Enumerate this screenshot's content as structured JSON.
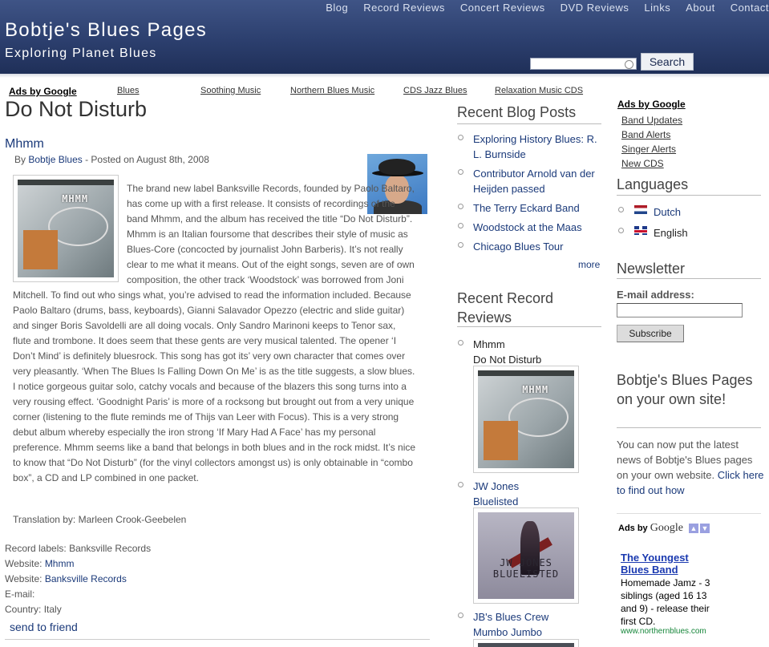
{
  "nav": [
    "Blog",
    "Record Reviews",
    "Concert Reviews",
    "DVD Reviews",
    "Links",
    "About",
    "Contact"
  ],
  "site": {
    "title": "Bobtje's Blues Pages",
    "subtitle": "Exploring Planet Blues"
  },
  "search": {
    "button": "Search",
    "value": ""
  },
  "ads_bar": {
    "label": "Ads by Google",
    "links": [
      "Blues",
      "Soothing Music",
      "Northern Blues Music",
      "CDS Jazz Blues",
      "Relaxation Music CDS"
    ]
  },
  "post": {
    "page_title": "Do Not Disturb",
    "title": "Mhmm",
    "by_prefix": "By",
    "author": "Bobtje Blues",
    "posted": " - Posted on August 8th, 2008",
    "cover_brand": "MHMM",
    "body": "The brand new label Banksville Records, founded by Paolo Baltaro, has come up with a first release. It consists of recordings of the band Mhmm, and the album has received the title “Do Not Disturb”. Mhmm is an Italian foursome that describes their style of music as Blues-Core (concocted by journalist John Barberis). It’s not really clear to me what it means. Out of the eight songs, seven are of own composition, the other track ‘Woodstock’ was borrowed from Joni Mitchell. To find out who sings what, you’re advised to read the information included. Because Paolo Baltaro (drums, bass, keyboards), Gianni Salavador Opezzo (electric and slide guitar) and singer Boris Savoldelli are all doing vocals. Only Sandro Marinoni keeps to Tenor sax, flute and trombone. It does seem that these gents are very musical talented. The opener ‘I Don’t Mind’ is definitely bluesrock. This song has got its’ very own character that comes over very pleasantly. ‘When The Blues Is Falling Down On Me’ is as the title suggests, a slow blues. I notice gorgeous guitar solo, catchy vocals and because of the blazers this song turns into a very rousing effect. ‘Goodnight Paris’ is more of a rocksong but brought out from a very unique corner (listening to the flute reminds me of Thijs van Leer with Focus). This is a very strong debut album whereby especially the iron strong ‘If Mary Had A Face’ has my personal preference. Mhmm seems like a band that belongs in both blues and in the rock midst. It’s nice to know that “Do Not Disturb” (for the vinyl collectors amongst us) is only obtainable in “combo box”, a CD and LP combined in one packet.",
    "translation": "Translation by: Marleen Crook-Geebelen",
    "meta": {
      "record_labels_label": "Record labels:",
      "record_labels_value": "Banksville Records",
      "website_label": "Website:",
      "website1": "Mhmm",
      "website2": "Banksville Records",
      "email_label": "E-mail:",
      "country_label": "Country:",
      "country_value": "Italy"
    },
    "send_to_friend": "send to friend"
  },
  "recent_blog": {
    "heading": "Recent Blog Posts",
    "items": [
      "Exploring History Blues: R. L. Burnside",
      "Contributor Arnold van der Heijden passed",
      "The Terry Eckard Band",
      "Woodstock at the Maas",
      "Chicago Blues Tour"
    ],
    "more": "more"
  },
  "recent_reviews": {
    "heading": "Recent Record Reviews",
    "items": [
      {
        "line1": "Mhmm",
        "line2": "Do Not Disturb"
      },
      {
        "line1": "JW Jones",
        "line2": "Bluelisted",
        "cover_text": "JW JONES BLUELISTED"
      },
      {
        "line1": "JB's Blues Crew",
        "line2": "Mumbo Jumbo"
      }
    ]
  },
  "sidebar": {
    "ads_label": "Ads by Google",
    "ads": [
      "Band Updates",
      "Band Alerts",
      "Singer Alerts",
      "New CDS"
    ],
    "languages_heading": "Languages",
    "languages": [
      "Dutch",
      "English"
    ],
    "newsletter_heading": "Newsletter",
    "email_label": "E-mail address:",
    "subscribe": "Subscribe",
    "own_site_heading": "Bobtje's Blues Pages on your own site!",
    "own_site_text": "You can now put the latest news of Bobtje's Blues pages on your own website. ",
    "own_site_link": "Click here to find out how",
    "gads_prefix": "Ads by",
    "gads_brand": "Google",
    "ad": {
      "title": "The Youngest Blues Band",
      "body": "Homemade Jamz - 3 siblings (aged 16 13 and 9) - release their first CD.",
      "url": "www.northernblues.com"
    }
  },
  "colors": {
    "header_top": "#3f5486",
    "header_bottom": "#1f2f58",
    "link": "#1b3a7a",
    "ad_url": "#16863a"
  }
}
